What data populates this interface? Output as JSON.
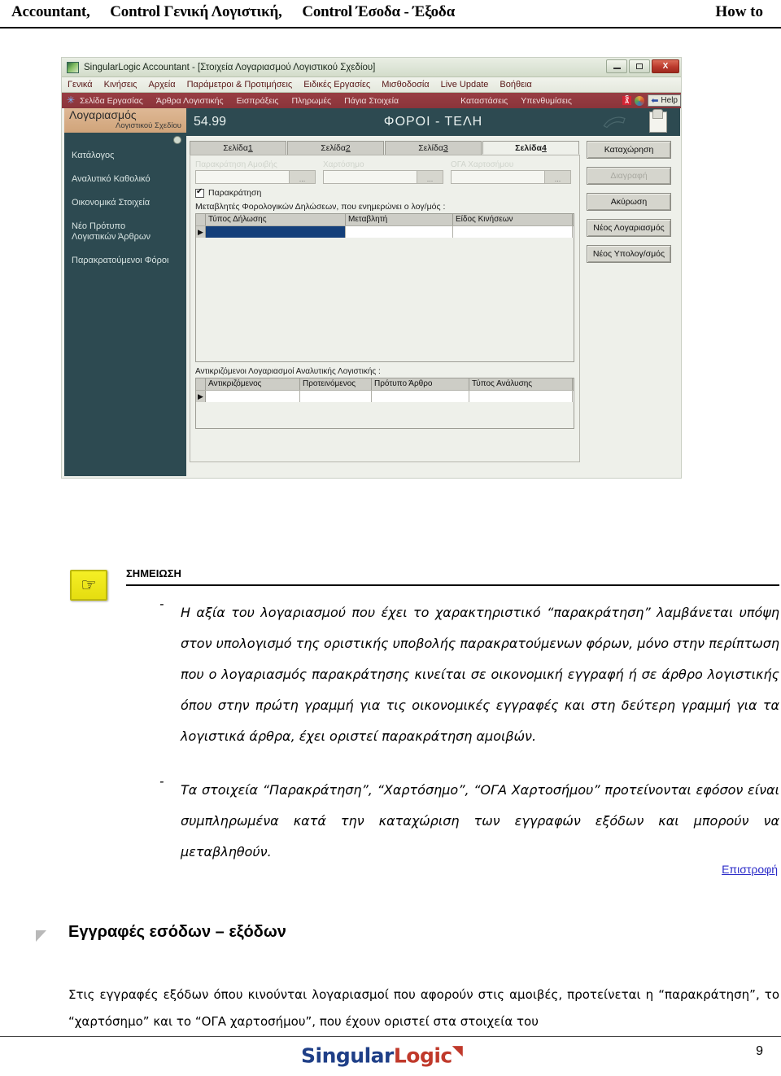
{
  "doc_header": {
    "breadcrumbs": [
      "Accountant,",
      "Control Γενική Λογιστική,",
      "Control Έσοδα - Έξοδα"
    ],
    "right_label": "How to"
  },
  "screenshot": {
    "titlebar": {
      "title": "SingularLogic Accountant - [Στοιχεία Λογαριασμού Λογιστικού Σχεδίου]",
      "minimize": "—",
      "maximize": "□",
      "close": "X"
    },
    "menubar": [
      "Γενικά",
      "Κινήσεις",
      "Αρχεία",
      "Παράμετροι & Προτιμήσεις",
      "Ειδικές Εργασίες",
      "Μισθοδοσία",
      "Live Update",
      "Βοήθεια"
    ],
    "toolbar": {
      "items": [
        "Σελίδα Εργασίας",
        "Άρθρα Λογιστικής",
        "Εισπράξεις",
        "Πληρωμές",
        "Πάγια Στοιχεία",
        "Καταστάσεις",
        "Υπενθυμίσεις"
      ],
      "help_label": "Help"
    },
    "sidebar": {
      "header_line1": "Λογαριασμός",
      "header_line2": "Λογιστικού Σχεδίου",
      "items": [
        "Κατάλογος",
        "Αναλυτικό Καθολικό",
        "Οικονομικά Στοιχεία",
        "Νέο Πρότυπο\nΛογιστικών Άρθρων",
        "Παρακρατούμενοι Φόροι"
      ]
    },
    "panel": {
      "code": "54.99",
      "title": "ΦΟΡΟΙ - ΤΕΛΗ",
      "tabs": [
        {
          "label": "Σελίδα ",
          "num": "1",
          "active": false
        },
        {
          "label": "Σελίδα ",
          "num": "2",
          "active": false
        },
        {
          "label": "Σελίδα ",
          "num": "3",
          "active": false
        },
        {
          "label": "Σελίδα ",
          "num": "4",
          "active": true
        }
      ],
      "fields": [
        {
          "label": "Παρακράτηση Αμοιβής",
          "value": "",
          "browse": "..."
        },
        {
          "label": "Χαρτόσημο",
          "value": "",
          "browse": "..."
        },
        {
          "label": "ΟΓΑ Χαρτοσήμου",
          "value": "",
          "browse": "..."
        }
      ],
      "checkbox_label": "Παρακράτηση",
      "grid1_caption": "Μεταβλητές Φορολογικών Δηλώσεων, που ενημερώνει ο λογ/μός :",
      "grid1_headers": [
        "Τύπος Δήλωσης",
        "Μεταβλητή",
        "Είδος Κινήσεων"
      ],
      "grid1_rows": [
        [
          "",
          "",
          ""
        ]
      ],
      "grid2_caption": "Αντικριζόμενοι Λογαριασμοί Αναλυτικής Λογιστικής :",
      "grid2_headers": [
        "Αντικριζόμενος",
        "Προτεινόμενος",
        "Πρότυπο Άρθρο",
        "Τύπος Ανάλυσης"
      ],
      "grid2_rows": [
        [
          "",
          "",
          "",
          ""
        ]
      ],
      "buttons": [
        {
          "label": "Καταχώρηση",
          "disabled": false
        },
        {
          "label": "Διαγραφή",
          "disabled": true
        },
        {
          "label": "Ακύρωση",
          "disabled": false
        },
        {
          "label": "Νέος Λογαριασμός",
          "disabled": false
        },
        {
          "label": "Νέος Υπολογ/σμός",
          "disabled": false
        }
      ]
    }
  },
  "note": {
    "icon": "☞",
    "title": "ΣΗΜΕΙΩΣΗ",
    "bullets": [
      {
        "dash": "-",
        "text": "Η αξία του λογαριασμού που έχει το χαρακτηριστικό “παρακράτηση” λαμβάνεται υπόψη στον υπολογισμό της οριστικής υποβολής παρακρατούμενων φόρων, μόνο στην περίπτωση που ο λογαριασμός παρακράτησης κινείται σε οικονομική εγγραφή ή σε άρθρο λογιστικής όπου στην πρώτη γραμμή για τις οικονομικές εγγραφές και στη δεύτερη γραμμή για τα λογιστικά άρθρα, έχει οριστεί παρακράτηση αμοιβών."
      },
      {
        "dash": "-",
        "text": "Τα στοιχεία “Παρακράτηση”, “Χαρτόσημο”, “ΟΓΑ Χαρτοσήμου” προτείνονται εφόσον είναι συμπληρωμένα κατά την καταχώριση των εγγραφών εξόδων και μπορούν να μεταβληθούν."
      }
    ],
    "back_link": "Επιστροφή"
  },
  "section": {
    "title": "Εγγραφές εσόδων – εξόδων",
    "paragraph": "Στις εγγραφές εξόδων όπου κινούνται λογαριασμοί που αφορούν στις αμοιβές, προτείνεται η “παρακράτηση”, το “χαρτόσημο” και το “ΟΓΑ χαρτοσήμου”, που έχουν οριστεί στα στοιχεία του"
  },
  "footer": {
    "logo_part1": "Singular",
    "logo_part2": "Logic",
    "logo_tick": "◥",
    "page_number": "9"
  }
}
